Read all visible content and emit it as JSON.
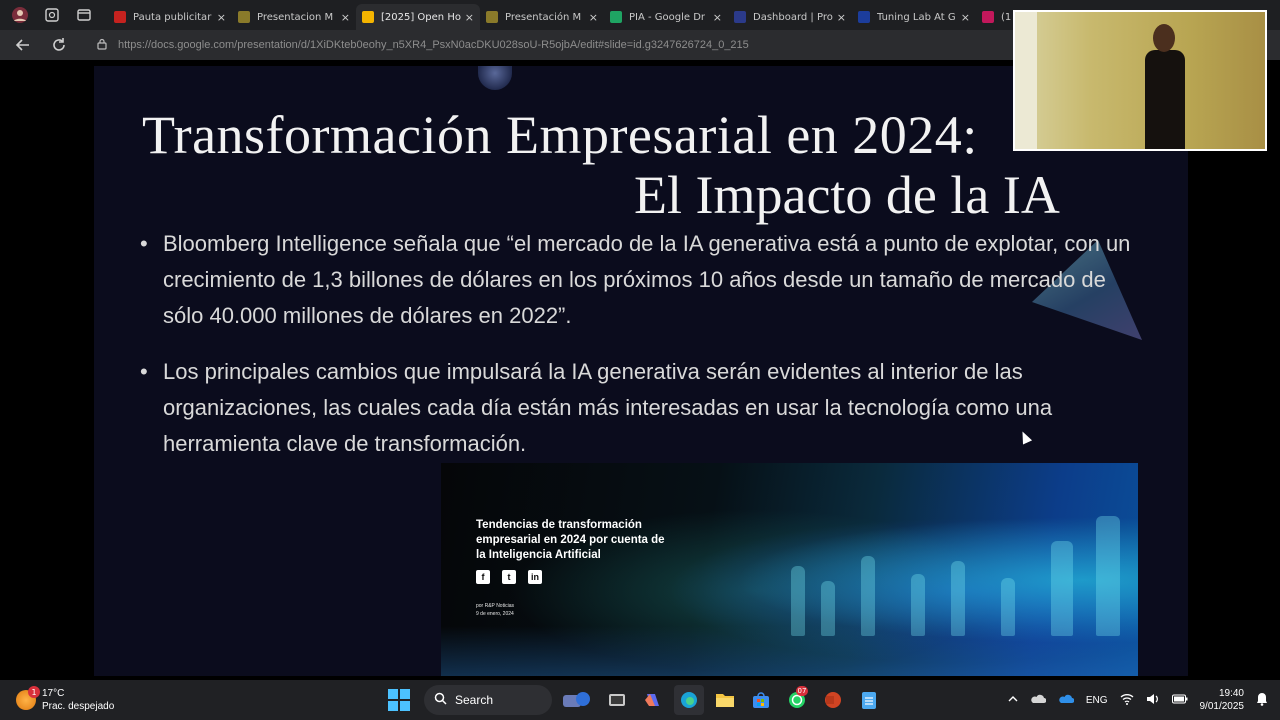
{
  "browser": {
    "tabs": [
      {
        "title": "Pauta publicitar",
        "fav_color": "#c5221f",
        "active": false
      },
      {
        "title": "Presentacion M",
        "fav_color": "#8a7a2a",
        "active": false
      },
      {
        "title": "[2025] Open Ho",
        "fav_color": "#f4b400",
        "active": true
      },
      {
        "title": "Presentación M",
        "fav_color": "#8a7a2a",
        "active": false
      },
      {
        "title": "PIA - Google Dr",
        "fav_color": "#1fa463",
        "active": false
      },
      {
        "title": "Dashboard | Pro",
        "fav_color": "#2b3a8a",
        "active": false
      },
      {
        "title": "Tuning Lab At G",
        "fav_color": "#1c3d9c",
        "active": false
      },
      {
        "title": "(1",
        "fav_color": "#c2185b",
        "active": false
      }
    ],
    "close_glyph": "×",
    "url": "https://docs.google.com/presentation/d/1XiDKteb0eohy_n5XR4_PsxN0acDKU028soU-R5ojbA/edit#slide=id.g3247626724_0_215"
  },
  "slide": {
    "title_line1": "Transformación Empresarial en 2024:",
    "title_line2": "El Impacto de la IA",
    "bullets": [
      "Bloomberg Intelligence señala que “el mercado de la IA generativa está a punto de explotar, con un crecimiento de 1,3 billones de dólares en los próximos 10 años desde un tamaño de mercado de sólo 40.000 millones de dólares en 2022”.",
      "Los principales cambios que impulsará la IA generativa serán evidentes al interior de las organizaciones, las cuales cada día están más interesadas en usar la tecnología como una herramienta clave de transformación."
    ],
    "article": {
      "title": "Tendencias de transformación empresarial en 2024 por cuenta de la Inteligencia Artificial",
      "social": [
        "f",
        "t",
        "in"
      ],
      "author": "por R&P Noticias",
      "date": "9 de enero, 2024"
    }
  },
  "taskbar": {
    "weather_temp": "17°C",
    "weather_desc": "Prac. despejado",
    "weather_badge": "1",
    "search_label": "Search",
    "whatsapp_badge": "07",
    "language": "ENG",
    "time": "19:40",
    "date": "9/01/2025"
  }
}
